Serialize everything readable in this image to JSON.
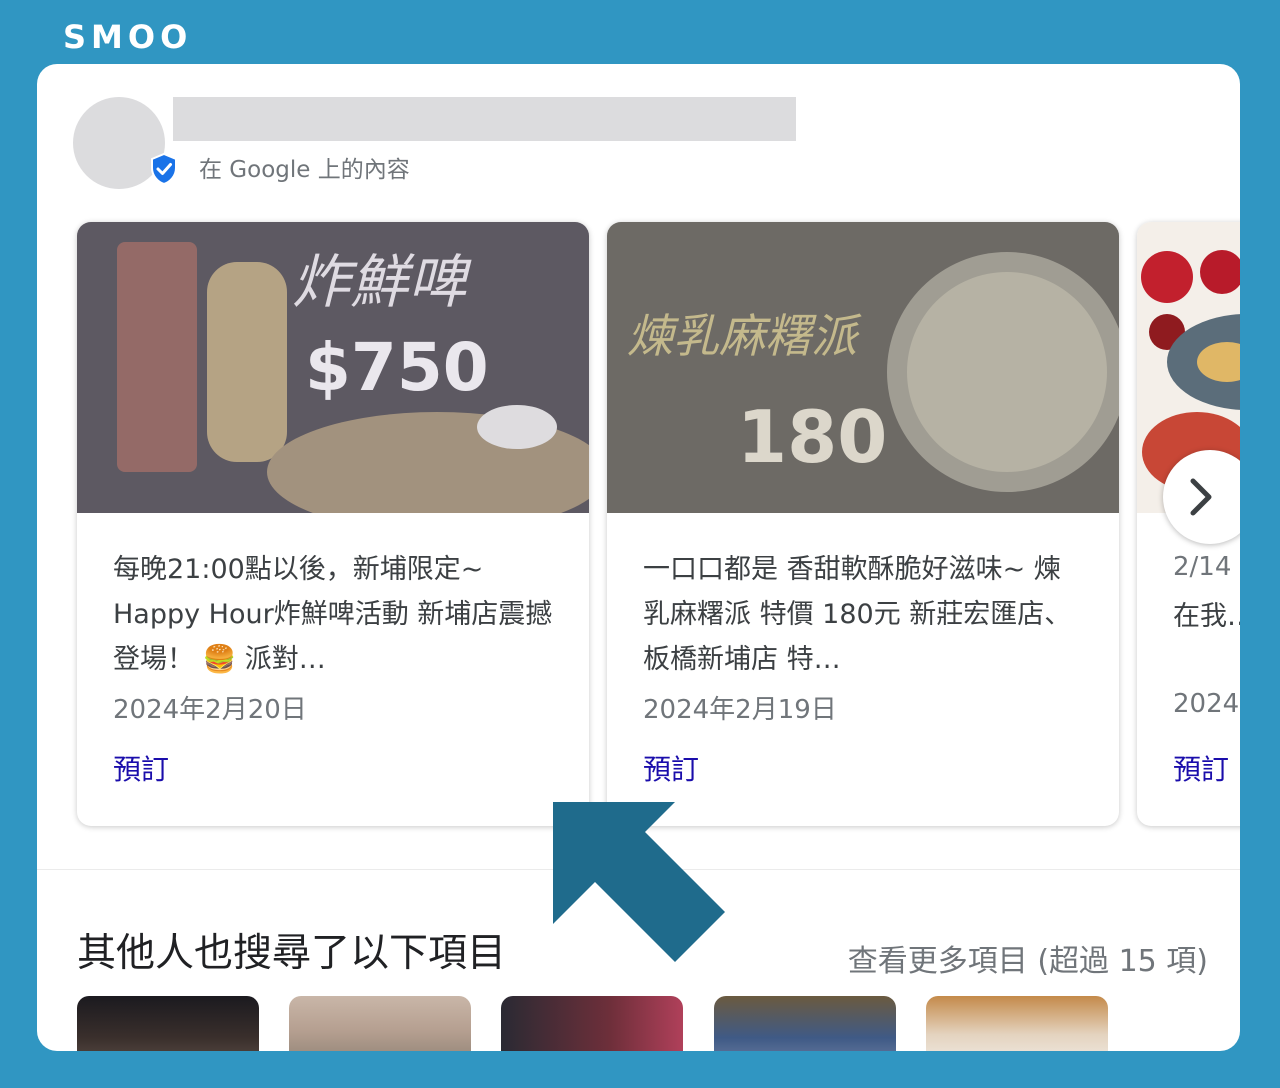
{
  "brand": {
    "logo_text": "SMOO"
  },
  "profile": {
    "source_label": "在 Google 上的內容"
  },
  "posts": [
    {
      "text": "每晚21:00點以後，新埔限定~ Happy Hour炸鮮啤活動 新埔店震撼登場！ 🍔 派對…",
      "date": "2024年2月20日",
      "cta": "預訂",
      "image_text": {
        "headline": "炸鮮啤",
        "price": "$750"
      }
    },
    {
      "text": "一口口都是 香甜軟酥脆好滋味~ 煉乳麻糬派 特價 180元 新莊宏匯店、板橋新埔店 特…",
      "date": "2024年2月19日",
      "cta": "預訂",
      "image_text": {
        "headline": "煉乳麻糬派",
        "price": "180"
      }
    },
    {
      "text": "在我… 在美…",
      "date": "2024",
      "cta": "預訂",
      "image_text": {
        "headline": "",
        "price": ""
      }
    }
  ],
  "partial_card_date_prefix": "2/14",
  "carousel": {
    "next_icon": "chevron-right-icon"
  },
  "people_also_search": {
    "title": "其他人也搜尋了以下項目",
    "see_more": "查看更多項目 (超過 15 項)",
    "thumb_count_visible": 5
  },
  "colors": {
    "background": "#3096c2",
    "annotation_arrow": "#1f6b8c",
    "link": "#1a0dab",
    "verified": "#1a73e8"
  }
}
